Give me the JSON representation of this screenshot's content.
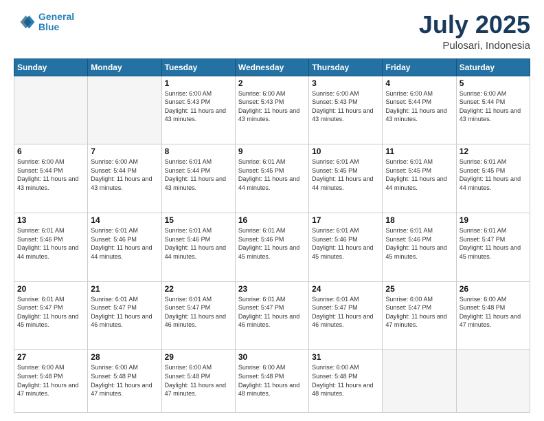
{
  "header": {
    "logo_line1": "General",
    "logo_line2": "Blue",
    "month": "July 2025",
    "location": "Pulosari, Indonesia"
  },
  "weekdays": [
    "Sunday",
    "Monday",
    "Tuesday",
    "Wednesday",
    "Thursday",
    "Friday",
    "Saturday"
  ],
  "weeks": [
    [
      {
        "day": "",
        "sunrise": "",
        "sunset": "",
        "daylight": "",
        "empty": true
      },
      {
        "day": "",
        "sunrise": "",
        "sunset": "",
        "daylight": "",
        "empty": true
      },
      {
        "day": "1",
        "sunrise": "Sunrise: 6:00 AM",
        "sunset": "Sunset: 5:43 PM",
        "daylight": "Daylight: 11 hours and 43 minutes."
      },
      {
        "day": "2",
        "sunrise": "Sunrise: 6:00 AM",
        "sunset": "Sunset: 5:43 PM",
        "daylight": "Daylight: 11 hours and 43 minutes."
      },
      {
        "day": "3",
        "sunrise": "Sunrise: 6:00 AM",
        "sunset": "Sunset: 5:43 PM",
        "daylight": "Daylight: 11 hours and 43 minutes."
      },
      {
        "day": "4",
        "sunrise": "Sunrise: 6:00 AM",
        "sunset": "Sunset: 5:44 PM",
        "daylight": "Daylight: 11 hours and 43 minutes."
      },
      {
        "day": "5",
        "sunrise": "Sunrise: 6:00 AM",
        "sunset": "Sunset: 5:44 PM",
        "daylight": "Daylight: 11 hours and 43 minutes."
      }
    ],
    [
      {
        "day": "6",
        "sunrise": "Sunrise: 6:00 AM",
        "sunset": "Sunset: 5:44 PM",
        "daylight": "Daylight: 11 hours and 43 minutes."
      },
      {
        "day": "7",
        "sunrise": "Sunrise: 6:00 AM",
        "sunset": "Sunset: 5:44 PM",
        "daylight": "Daylight: 11 hours and 43 minutes."
      },
      {
        "day": "8",
        "sunrise": "Sunrise: 6:01 AM",
        "sunset": "Sunset: 5:44 PM",
        "daylight": "Daylight: 11 hours and 43 minutes."
      },
      {
        "day": "9",
        "sunrise": "Sunrise: 6:01 AM",
        "sunset": "Sunset: 5:45 PM",
        "daylight": "Daylight: 11 hours and 44 minutes."
      },
      {
        "day": "10",
        "sunrise": "Sunrise: 6:01 AM",
        "sunset": "Sunset: 5:45 PM",
        "daylight": "Daylight: 11 hours and 44 minutes."
      },
      {
        "day": "11",
        "sunrise": "Sunrise: 6:01 AM",
        "sunset": "Sunset: 5:45 PM",
        "daylight": "Daylight: 11 hours and 44 minutes."
      },
      {
        "day": "12",
        "sunrise": "Sunrise: 6:01 AM",
        "sunset": "Sunset: 5:45 PM",
        "daylight": "Daylight: 11 hours and 44 minutes."
      }
    ],
    [
      {
        "day": "13",
        "sunrise": "Sunrise: 6:01 AM",
        "sunset": "Sunset: 5:46 PM",
        "daylight": "Daylight: 11 hours and 44 minutes."
      },
      {
        "day": "14",
        "sunrise": "Sunrise: 6:01 AM",
        "sunset": "Sunset: 5:46 PM",
        "daylight": "Daylight: 11 hours and 44 minutes."
      },
      {
        "day": "15",
        "sunrise": "Sunrise: 6:01 AM",
        "sunset": "Sunset: 5:46 PM",
        "daylight": "Daylight: 11 hours and 44 minutes."
      },
      {
        "day": "16",
        "sunrise": "Sunrise: 6:01 AM",
        "sunset": "Sunset: 5:46 PM",
        "daylight": "Daylight: 11 hours and 45 minutes."
      },
      {
        "day": "17",
        "sunrise": "Sunrise: 6:01 AM",
        "sunset": "Sunset: 5:46 PM",
        "daylight": "Daylight: 11 hours and 45 minutes."
      },
      {
        "day": "18",
        "sunrise": "Sunrise: 6:01 AM",
        "sunset": "Sunset: 5:46 PM",
        "daylight": "Daylight: 11 hours and 45 minutes."
      },
      {
        "day": "19",
        "sunrise": "Sunrise: 6:01 AM",
        "sunset": "Sunset: 5:47 PM",
        "daylight": "Daylight: 11 hours and 45 minutes."
      }
    ],
    [
      {
        "day": "20",
        "sunrise": "Sunrise: 6:01 AM",
        "sunset": "Sunset: 5:47 PM",
        "daylight": "Daylight: 11 hours and 45 minutes."
      },
      {
        "day": "21",
        "sunrise": "Sunrise: 6:01 AM",
        "sunset": "Sunset: 5:47 PM",
        "daylight": "Daylight: 11 hours and 46 minutes."
      },
      {
        "day": "22",
        "sunrise": "Sunrise: 6:01 AM",
        "sunset": "Sunset: 5:47 PM",
        "daylight": "Daylight: 11 hours and 46 minutes."
      },
      {
        "day": "23",
        "sunrise": "Sunrise: 6:01 AM",
        "sunset": "Sunset: 5:47 PM",
        "daylight": "Daylight: 11 hours and 46 minutes."
      },
      {
        "day": "24",
        "sunrise": "Sunrise: 6:01 AM",
        "sunset": "Sunset: 5:47 PM",
        "daylight": "Daylight: 11 hours and 46 minutes."
      },
      {
        "day": "25",
        "sunrise": "Sunrise: 6:00 AM",
        "sunset": "Sunset: 5:47 PM",
        "daylight": "Daylight: 11 hours and 47 minutes."
      },
      {
        "day": "26",
        "sunrise": "Sunrise: 6:00 AM",
        "sunset": "Sunset: 5:48 PM",
        "daylight": "Daylight: 11 hours and 47 minutes."
      }
    ],
    [
      {
        "day": "27",
        "sunrise": "Sunrise: 6:00 AM",
        "sunset": "Sunset: 5:48 PM",
        "daylight": "Daylight: 11 hours and 47 minutes."
      },
      {
        "day": "28",
        "sunrise": "Sunrise: 6:00 AM",
        "sunset": "Sunset: 5:48 PM",
        "daylight": "Daylight: 11 hours and 47 minutes."
      },
      {
        "day": "29",
        "sunrise": "Sunrise: 6:00 AM",
        "sunset": "Sunset: 5:48 PM",
        "daylight": "Daylight: 11 hours and 47 minutes."
      },
      {
        "day": "30",
        "sunrise": "Sunrise: 6:00 AM",
        "sunset": "Sunset: 5:48 PM",
        "daylight": "Daylight: 11 hours and 48 minutes."
      },
      {
        "day": "31",
        "sunrise": "Sunrise: 6:00 AM",
        "sunset": "Sunset: 5:48 PM",
        "daylight": "Daylight: 11 hours and 48 minutes."
      },
      {
        "day": "",
        "sunrise": "",
        "sunset": "",
        "daylight": "",
        "empty": true
      },
      {
        "day": "",
        "sunrise": "",
        "sunset": "",
        "daylight": "",
        "empty": true
      }
    ]
  ]
}
